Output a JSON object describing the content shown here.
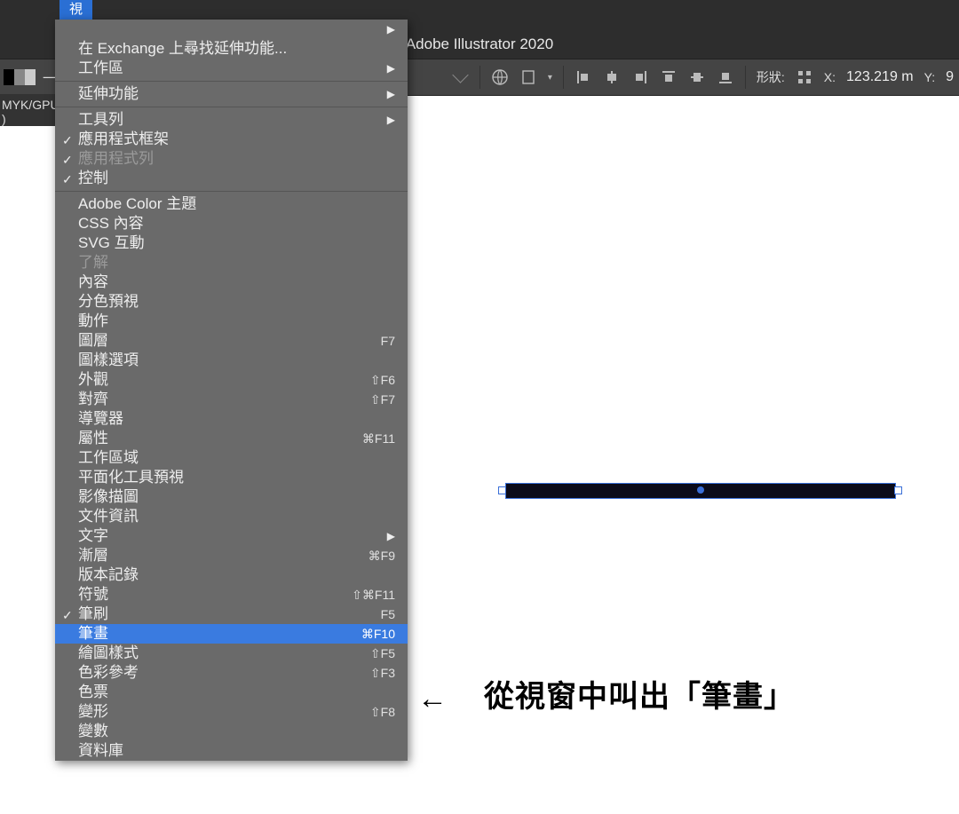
{
  "app": {
    "title": "Adobe Illustrator 2020"
  },
  "menubar": {
    "active_tab": "視"
  },
  "infobar": {
    "text": "MYK/GPU )"
  },
  "toolbar": {
    "left_label": "一致",
    "shape_label": "形狀:",
    "x_label": "X:",
    "x_value": "123.219 m",
    "y_label": "Y:",
    "y_value": "9"
  },
  "menu": {
    "items": [
      {
        "label": "",
        "arrow": true,
        "truncated_top": true
      },
      {
        "label": "在 Exchange 上尋找延伸功能..."
      },
      {
        "label": "工作區",
        "arrow": true
      },
      {
        "sep": true
      },
      {
        "label": "延伸功能",
        "arrow": true
      },
      {
        "sep": true
      },
      {
        "label": "工具列",
        "arrow": true
      },
      {
        "label": "應用程式框架",
        "checked": true
      },
      {
        "label": "應用程式列",
        "checked": true,
        "disabled": true
      },
      {
        "label": "控制",
        "checked": true
      },
      {
        "sep": true
      },
      {
        "label": "Adobe Color 主題"
      },
      {
        "label": "CSS 內容"
      },
      {
        "label": "SVG 互動"
      },
      {
        "label": "了解",
        "disabled": true
      },
      {
        "label": "內容"
      },
      {
        "label": "分色預視"
      },
      {
        "label": "動作"
      },
      {
        "label": "圖層",
        "shortcut": "F7"
      },
      {
        "label": "圖樣選項"
      },
      {
        "label": "外觀",
        "shortcut": "⇧F6"
      },
      {
        "label": "對齊",
        "shortcut": "⇧F7"
      },
      {
        "label": "導覽器"
      },
      {
        "label": "屬性",
        "shortcut": "⌘F11"
      },
      {
        "label": "工作區域"
      },
      {
        "label": "平面化工具預視"
      },
      {
        "label": "影像描圖"
      },
      {
        "label": "文件資訊"
      },
      {
        "label": "文字",
        "arrow": true
      },
      {
        "label": "漸層",
        "shortcut": "⌘F9"
      },
      {
        "label": "版本記錄"
      },
      {
        "label": "符號",
        "shortcut": "⇧⌘F11"
      },
      {
        "label": "筆刷",
        "checked": true,
        "shortcut": "F5"
      },
      {
        "label": "筆畫",
        "shortcut": "⌘F10",
        "selected": true
      },
      {
        "label": "繪圖樣式",
        "shortcut": "⇧F5"
      },
      {
        "label": "色彩參考",
        "shortcut": "⇧F3"
      },
      {
        "label": "色票"
      },
      {
        "label": "變形",
        "shortcut": "⇧F8"
      },
      {
        "label": "變數"
      },
      {
        "label": "資料庫"
      }
    ]
  },
  "annotation": {
    "arrow": "←",
    "text": "從視窗中叫出「筆畫」"
  }
}
